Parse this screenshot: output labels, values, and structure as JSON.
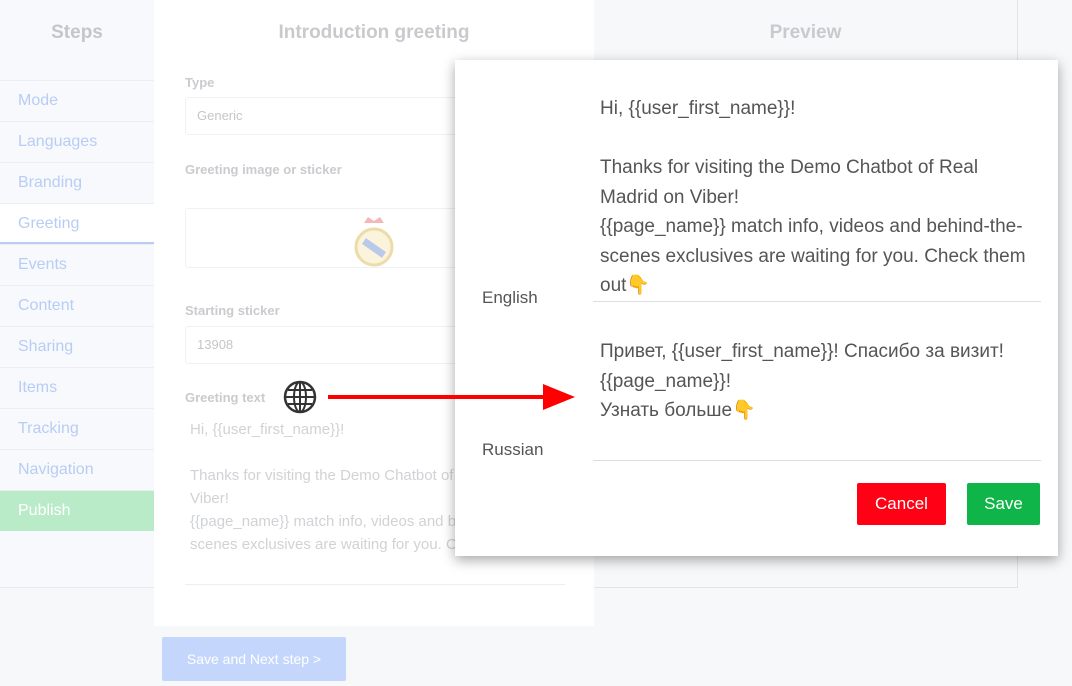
{
  "sidebar": {
    "title": "Steps",
    "items": [
      "Mode",
      "Languages",
      "Branding",
      "Greeting",
      "Events",
      "Content",
      "Sharing",
      "Items",
      "Tracking",
      "Navigation",
      "Publish"
    ],
    "active": "Greeting"
  },
  "main": {
    "title": "Introduction greeting",
    "type_label": "Type",
    "type_value": "Generic",
    "image_label": "Greeting image or sticker",
    "sticker_label": "Starting sticker",
    "sticker_value": "13908",
    "greeting_label": "Greeting text",
    "greeting_text": "Hi, {{user_first_name}}!\n\nThanks for visiting the Demo Chatbot of Real Madrid on Viber!\n{{page_name}} match info, videos and behind-the-scenes exclusives are waiting for you. Check them out👇",
    "save_next": "Save and Next step >"
  },
  "preview": {
    "title": "Preview"
  },
  "modal": {
    "languages": [
      {
        "name": "English",
        "text": "Hi, {{user_first_name}}!\n\nThanks for visiting the Demo Chatbot of Real Madrid on Viber!\n{{page_name}} match info, videos and behind-the-scenes exclusives are waiting for you. Check them out👇"
      },
      {
        "name": "Russian",
        "text": "Привет, {{user_first_name}}! Спасибо за визит!\n{{page_name}}!\nУзнать больше👇"
      }
    ],
    "cancel": "Cancel",
    "save": "Save"
  },
  "colors": {
    "cancel": "#ff0015",
    "save": "#10b54a",
    "arrow": "#ff0000",
    "publish": "#b9ebc9",
    "step_text": "#b8cdf5"
  }
}
